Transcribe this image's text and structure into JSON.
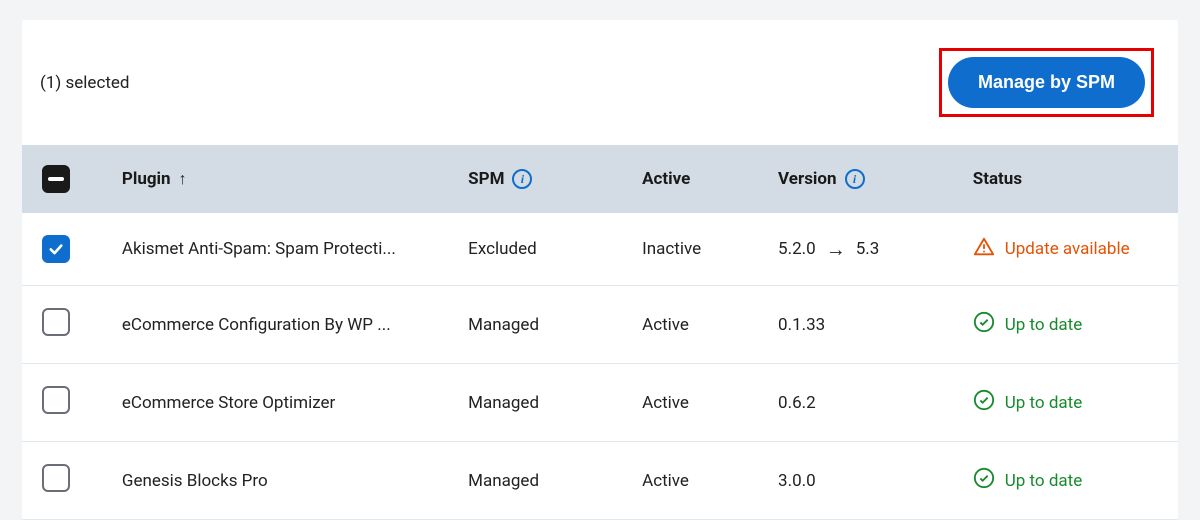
{
  "toolbar": {
    "selection_text": "(1) selected",
    "primary_button": "Manage by SPM"
  },
  "table": {
    "headers": {
      "plugin": "Plugin",
      "spm": "SPM",
      "active": "Active",
      "version": "Version",
      "status": "Status"
    },
    "rows": [
      {
        "checked": true,
        "name": "Akismet Anti-Spam: Spam Protecti...",
        "spm": "Excluded",
        "active": "Inactive",
        "version_from": "5.2.0",
        "version_to": "5.3",
        "status_kind": "warn",
        "status_text": "Update available"
      },
      {
        "checked": false,
        "name": "eCommerce Configuration By WP ...",
        "spm": "Managed",
        "active": "Active",
        "version_from": "0.1.33",
        "version_to": "",
        "status_kind": "ok",
        "status_text": "Up to date"
      },
      {
        "checked": false,
        "name": "eCommerce Store Optimizer",
        "spm": "Managed",
        "active": "Active",
        "version_from": "0.6.2",
        "version_to": "",
        "status_kind": "ok",
        "status_text": "Up to date"
      },
      {
        "checked": false,
        "name": "Genesis Blocks Pro",
        "spm": "Managed",
        "active": "Active",
        "version_from": "3.0.0",
        "version_to": "",
        "status_kind": "ok",
        "status_text": "Up to date"
      }
    ]
  },
  "colors": {
    "primary": "#0f6ecd",
    "ok": "#178a2e",
    "warn": "#e35205",
    "highlight": "#e60000"
  }
}
